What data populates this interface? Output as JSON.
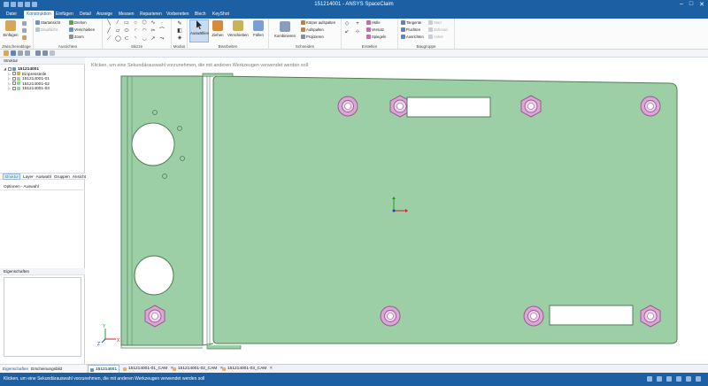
{
  "window": {
    "title": "151214001 - ANSYS SpaceClaim",
    "min_glyph": "–",
    "max_glyph": "□",
    "close_glyph": "✕"
  },
  "ribbon_tabs": [
    "Datei",
    "Konstruktion",
    "Einfügen",
    "Detail",
    "Anzeige",
    "Messen",
    "Reparieren",
    "Vorbereiten",
    "Blech",
    "KeyShot"
  ],
  "ribbon_active_tab": "Konstruktion",
  "ribbon": {
    "clipboard": {
      "paste": "Einfügen",
      "group": "Zwischenablage"
    },
    "orient": {
      "start_view": "Startansicht",
      "plan_view": "Draufsicht",
      "rotate": "Drehen",
      "pan": "Verschieben",
      "zoom": "Zoom",
      "group": "Ausrichten"
    },
    "sketch": {
      "group": "Skizze"
    },
    "mode": {
      "group": "Modus"
    },
    "edit": {
      "select": "Auswählen",
      "pull": "Ziehen",
      "move": "Verschieben",
      "fill": "Füllen",
      "group": "Bearbeiten"
    },
    "intersect": {
      "combine": "Kombinieren",
      "split_body": "Körper aufspalten",
      "split": "Aufspalten",
      "project": "Projizieren",
      "group": "Schneiden"
    },
    "create": {
      "shell": "Hülle",
      "offset": "Versatz",
      "mirror": "Spiegeln",
      "group": "Erstellen"
    },
    "assembly": {
      "tangent": "Tangente",
      "align": "Fluchten",
      "orient": "Ausrichten",
      "rigid": "Starr",
      "gear": "Zahnrad",
      "anchor": "Anker",
      "group": "Baugruppe"
    }
  },
  "structure": {
    "header": "Struktur",
    "root": "151214001",
    "items": [
      "Einpressteile",
      "151214001-01",
      "151214001-02",
      "151214001-03"
    ]
  },
  "panel_tabs": [
    "Struktur",
    "Layer",
    "Auswahl",
    "Gruppen",
    "Ansichten"
  ],
  "options_label": "Optionen - Auswahl",
  "properties_label": "Eigenschaften",
  "bottom_tabs": [
    "Eigenschaften",
    "Erscheinungsbild"
  ],
  "viewport_hint": "Klicken, um eine Sekundärauswahl vorzunehmen, die mit anderen Werkzeugen verwendet werden soll",
  "doc_tabs": [
    "151214001",
    "151214001-01_CAM",
    "151214001-02_CAM",
    "151214001-03_CAM"
  ],
  "doc_tab_close": "✕",
  "status_text": "Klicken, um eine Sekundärauswahl vorzunehmen, die mit anderen Werkzeugen verwendet werden soll",
  "triad_labels": {
    "x": "X",
    "y": "Y",
    "z": "Z"
  },
  "colors": {
    "title_blue": "#1d5fa3",
    "plate_fill": "#9ccfa5",
    "plate_edge": "#4f7e58",
    "pem_fill": "#d9a7d3",
    "pem_edge": "#9a5a93"
  }
}
